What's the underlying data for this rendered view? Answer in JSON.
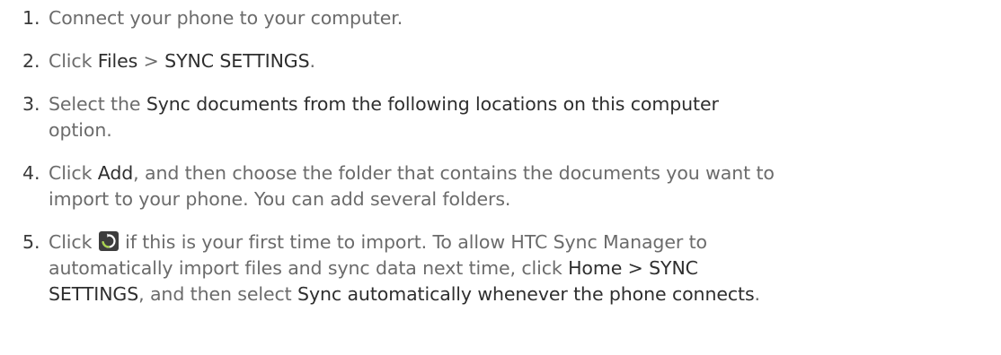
{
  "steps": [
    {
      "number": "1.",
      "text": "Connect your phone to your computer."
    },
    {
      "number": "2.",
      "t1": "Click ",
      "ui1": "Files",
      "t2": " > ",
      "ui2": "SYNC SETTINGS",
      "t3": "."
    },
    {
      "number": "3.",
      "t1": "Select the ",
      "ui1": "Sync documents from the following locations on this computer",
      "t2": "option."
    },
    {
      "number": "4.",
      "t1": "Click ",
      "ui1": "Add",
      "t2": ", and then choose the folder that contains the documents you want to",
      "t3": "import to your phone. You can add several folders."
    },
    {
      "number": "5.",
      "t1": "Click ",
      "icon": "sync-icon",
      "t2": " if this is your first time to import. To allow HTC Sync Manager to",
      "t3": "automatically import files and sync data next time, click ",
      "ui1": "Home",
      "t4": " > SYNC",
      "t5": "SETTINGS",
      "t6": ", and then select ",
      "ui2": "Sync automatically whenever the phone connects",
      "t7": "."
    }
  ],
  "colors": {
    "body_text": "#6b6b6b",
    "ui_term": "#2e2e2e",
    "icon_bg": "#3d3d3d",
    "icon_accent": "#a8d34a"
  }
}
